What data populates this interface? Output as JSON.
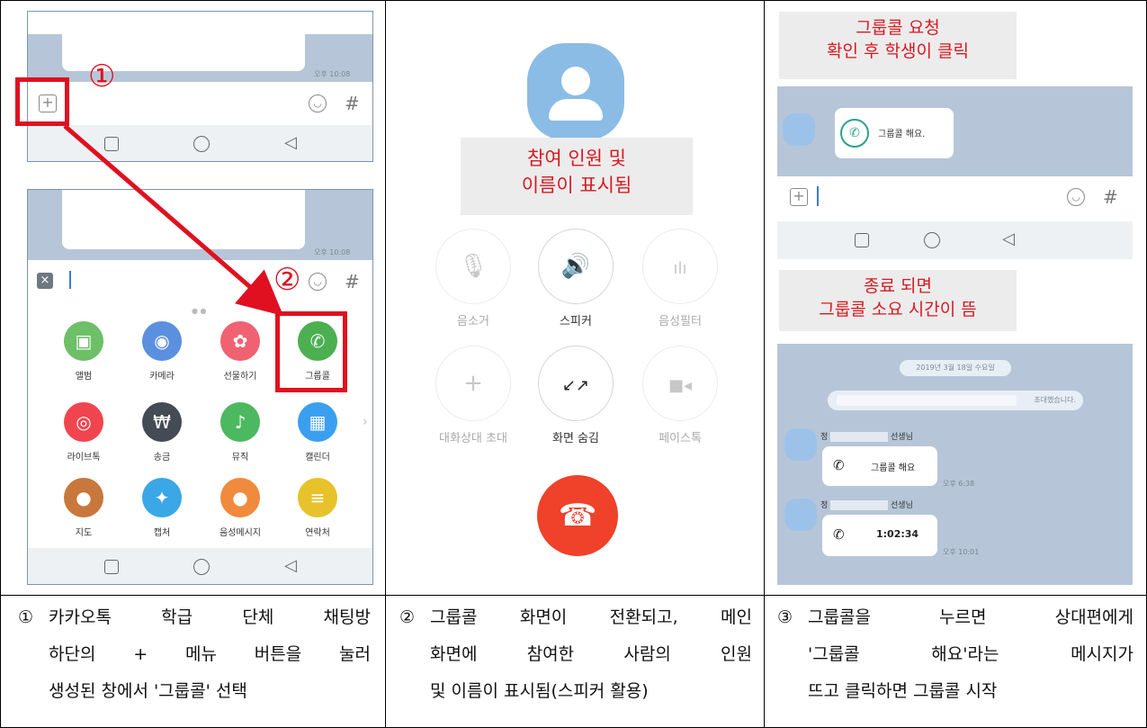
{
  "steps": [
    {
      "number": "①",
      "caption_lines": [
        "카카오톡 학급 단체 채팅방",
        "하단의 + 메뉴 버튼을 눌러",
        "생성된 창에서 '그룹콜' 선택"
      ],
      "callouts": [
        "①",
        "②"
      ],
      "chat_time": "오후 10:08",
      "apps": [
        {
          "label": "앨범",
          "icon": "album-icon",
          "color": "#6dbf68"
        },
        {
          "label": "카메라",
          "icon": "camera-icon",
          "color": "#5b8fe0"
        },
        {
          "label": "선물하기",
          "icon": "gift-icon",
          "color": "#f06272"
        },
        {
          "label": "그룹콜",
          "icon": "phone-icon",
          "color": "#4caf50"
        },
        {
          "label": "라이브톡",
          "icon": "live-icon",
          "color": "#f0454f"
        },
        {
          "label": "송금",
          "icon": "won-icon",
          "color": "#444b55"
        },
        {
          "label": "뮤직",
          "icon": "music-icon",
          "color": "#4cb860"
        },
        {
          "label": "캘린더",
          "icon": "calendar-icon",
          "color": "#3b9ff0"
        },
        {
          "label": "지도",
          "icon": "map-pin-icon",
          "color": "#c8783c"
        },
        {
          "label": "캡처",
          "icon": "capture-icon",
          "color": "#3aa7e6"
        },
        {
          "label": "음성메시지",
          "icon": "mic-icon",
          "color": "#f08a3c"
        },
        {
          "label": "연락처",
          "icon": "contacts-icon",
          "color": "#e8c22a"
        }
      ]
    },
    {
      "number": "②",
      "caption_lines": [
        "그룹콜 화면이 전환되고, 메인",
        "화면에 참여한 사람의 인원",
        "및 이름이 표시됨(스피커 활용)"
      ],
      "note_lines": [
        "참여 인원 및",
        "이름이 표시됨"
      ],
      "controls": [
        {
          "label": "음소거",
          "icon": "mute-icon",
          "glyph": "🎙",
          "dim": true
        },
        {
          "label": "스피커",
          "icon": "speaker-icon",
          "glyph": "🔊",
          "dim": false
        },
        {
          "label": "음성필터",
          "icon": "voice-filter-icon",
          "glyph": "ılı",
          "dim": true
        },
        {
          "label": "대화상대 초대",
          "icon": "plus-icon",
          "glyph": "+",
          "dim": true
        },
        {
          "label": "화면 숨김",
          "icon": "minimize-icon",
          "glyph": "↙↗",
          "dim": false
        },
        {
          "label": "페이스톡",
          "icon": "video-icon",
          "glyph": "■◂",
          "dim": true
        }
      ],
      "end_call_icon": "end-call-icon"
    },
    {
      "number": "③",
      "caption_lines": [
        "그룹콜을 누르면 상대편에게",
        "'그룹콜 해요'라는 메시지가",
        "뜨고 클릭하면 그룹콜 시작"
      ],
      "note_top_lines": [
        "그룹콜 요청",
        "확인 후 학생이 클릭"
      ],
      "note_bottom_lines": [
        "종료 되면",
        "그룹콜 소요 시간이 뜸"
      ],
      "groupcall_message": "그룹콜 해요.",
      "date_pill": "2019년 3월 18일 수요일",
      "invite_text": "초대했습니다.",
      "sender_prefix": "정",
      "sender_suffix": "선생님",
      "msg1": "그룹콜 해요",
      "msg1_time": "오후 6:38",
      "msg2": "1:02:34",
      "msg2_time": "오후 10:01"
    }
  ]
}
